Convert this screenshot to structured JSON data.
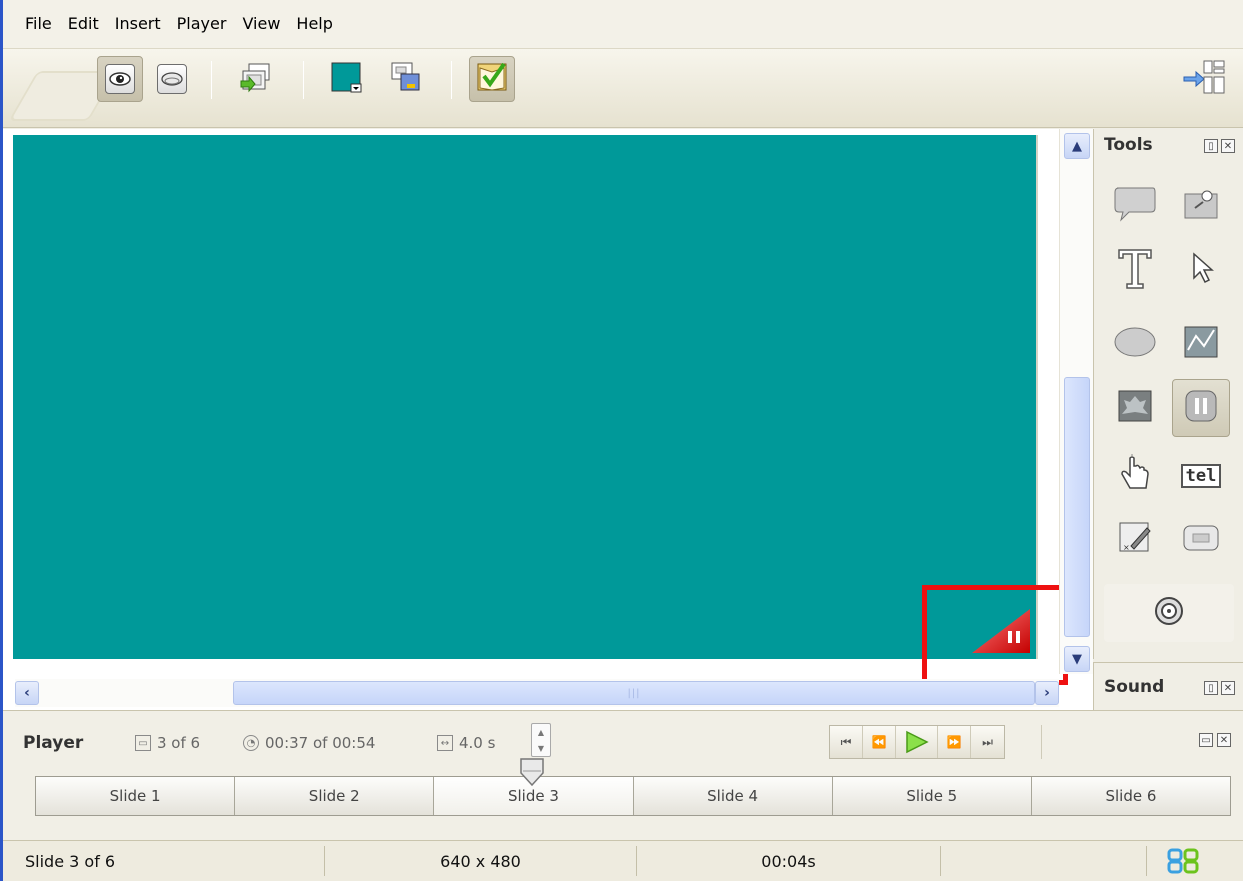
{
  "menu": [
    "File",
    "Edit",
    "Insert",
    "Player",
    "View",
    "Help"
  ],
  "toolbar": {
    "buttons": [
      "preview-eye",
      "preview-ellipse",
      "insert-slide",
      "background-color",
      "slide-properties",
      "publish-checklist"
    ],
    "background_color": "#009999"
  },
  "stage": {
    "background": "#009999"
  },
  "tools": {
    "title": "Tools",
    "items": [
      "callout",
      "image",
      "text",
      "cursor",
      "shape",
      "chart",
      "picture",
      "pause",
      "click",
      "text-entry",
      "quiz",
      "button",
      "rollover"
    ],
    "text_entry_label": "tel"
  },
  "sound": {
    "title": "Sound"
  },
  "player": {
    "title": "Player",
    "slide_counter": "3 of 6",
    "time": "00:37 of 00:54",
    "duration": "4.0 s",
    "slides": [
      "Slide 1",
      "Slide 2",
      "Slide 3",
      "Slide 4",
      "Slide 5",
      "Slide 6"
    ],
    "current_slide_index": 2
  },
  "status": {
    "slide": "Slide 3 of 6",
    "resolution": "640 x 480",
    "time": "00:04s"
  },
  "colors": {
    "accent": "#2b55c8",
    "highlight": "#ee1111",
    "play": "#6cc31d"
  }
}
